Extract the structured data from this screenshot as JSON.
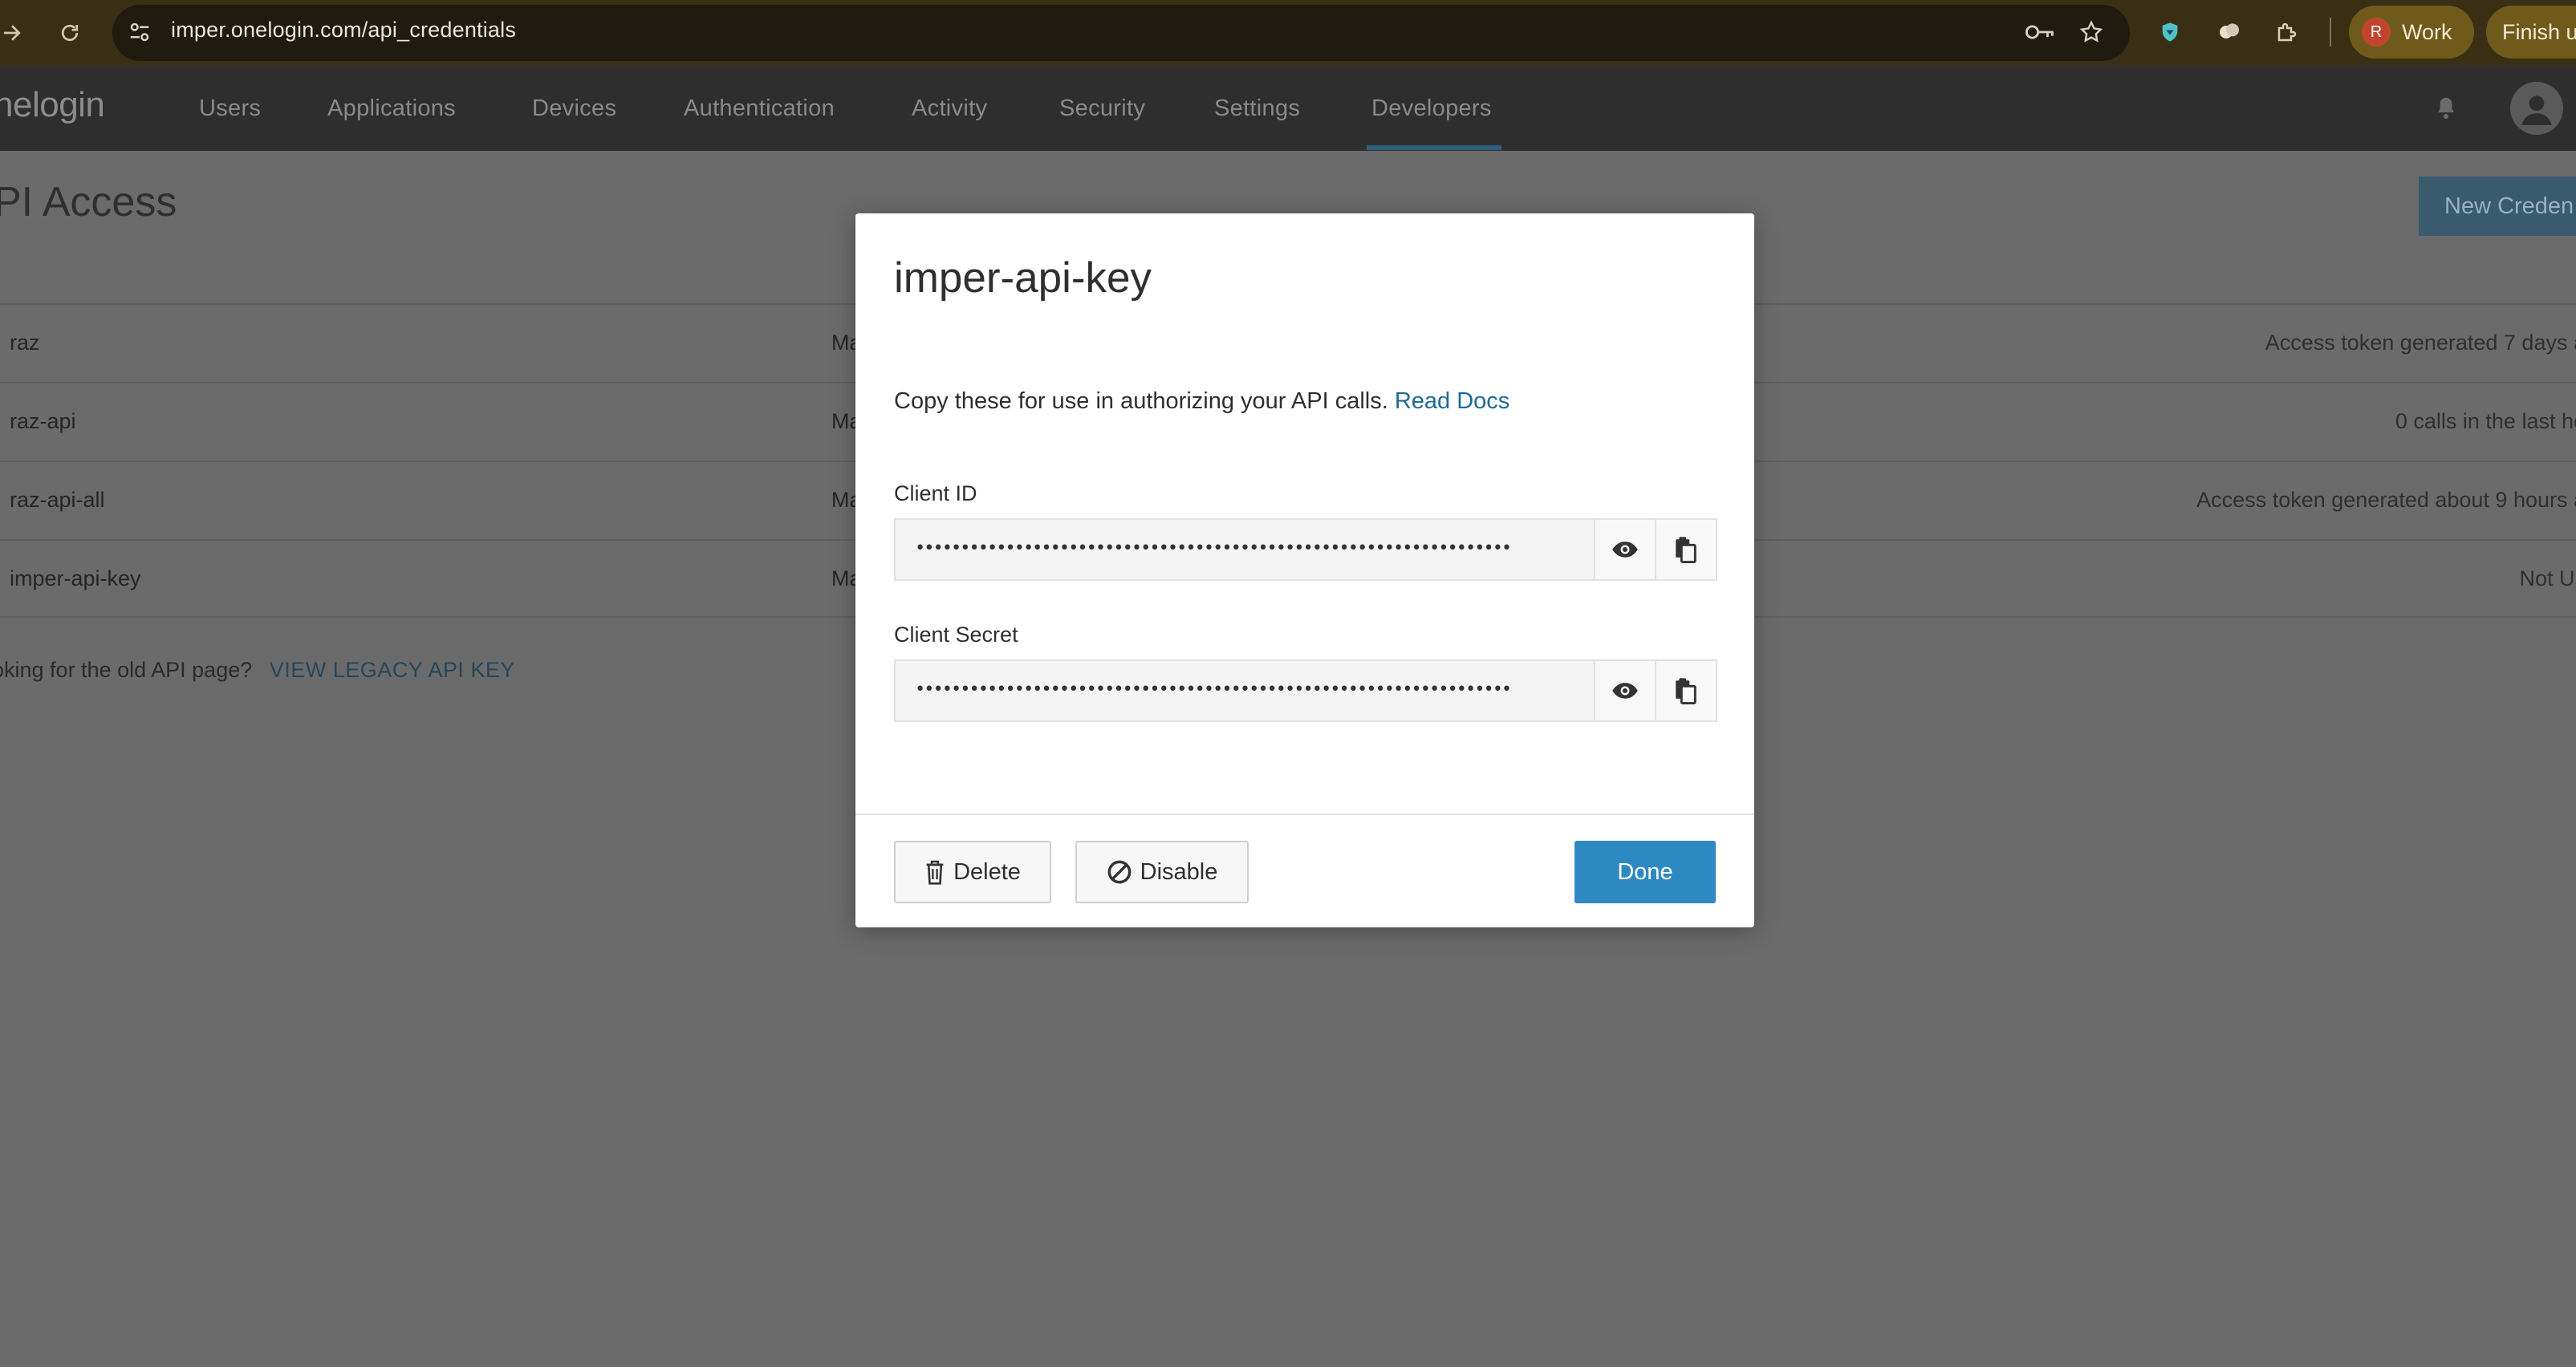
{
  "browser": {
    "url": "imper.onelogin.com/api_credentials",
    "profile_initial": "R",
    "profile_name": "Work",
    "finish_label": "Finish u"
  },
  "app": {
    "logo": "nelogin",
    "nav": [
      "Users",
      "Applications",
      "Devices",
      "Authentication",
      "Activity",
      "Security",
      "Settings",
      "Developers"
    ],
    "active_nav": "Developers"
  },
  "page": {
    "title": "PI Access",
    "new_button": "New Creden",
    "rows": [
      {
        "name": "raz",
        "scope": "Ma",
        "status": "Access token generated 7 days a"
      },
      {
        "name": "raz-api",
        "scope": "Ma",
        "status": "0 calls in the last ho"
      },
      {
        "name": "raz-api-all",
        "scope": "Ma",
        "status": "Access token generated about 9 hours a"
      },
      {
        "name": "imper-api-key",
        "scope": "Ma",
        "status": "Not Us"
      }
    ],
    "legacy_text": "oking for the old API page?",
    "legacy_link": "VIEW LEGACY API KEY"
  },
  "modal": {
    "title": "imper-api-key",
    "description": "Copy these for use in authorizing your API calls.",
    "docs_link": "Read Docs",
    "client_id_label": "Client ID",
    "client_id_value": "••••••••••••••••••••••••••••••••••••••••••••••••••••••••••••••••••",
    "client_secret_label": "Client Secret",
    "client_secret_value": "••••••••••••••••••••••••••••••••••••••••••••••••••••••••••••••••••",
    "delete_label": "Delete",
    "disable_label": "Disable",
    "done_label": "Done"
  },
  "colors": {
    "chrome_bg": "#382f14",
    "appbar_bg": "#2e2e2e",
    "overlay_bg": "#6b6b6b",
    "accent": "#2e89c2",
    "link": "#1f6a93"
  }
}
